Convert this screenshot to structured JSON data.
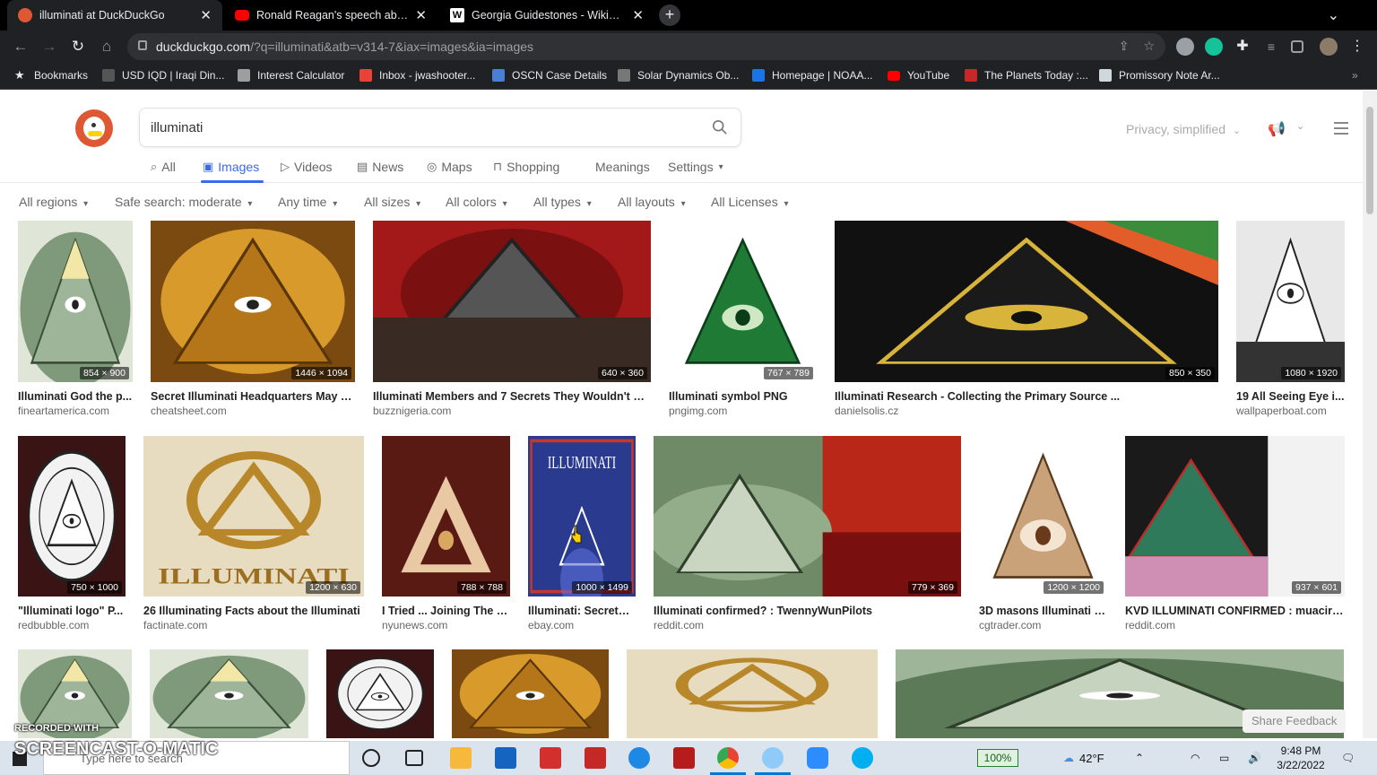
{
  "browser": {
    "tabs": [
      {
        "title": "illuminati at DuckDuckGo",
        "favicon_color": "#de5833",
        "active": true
      },
      {
        "title": "Ronald Reagan's speech about a",
        "favicon_color": "#ff0000",
        "active": false
      },
      {
        "title": "Georgia Guidestones - Wikipedia",
        "favicon_color": "#ffffff",
        "active": false
      }
    ],
    "new_tab": "+",
    "url_host": "duckduckgo.com",
    "url_path": "/?q=illuminati&atb=v314-7&iax=images&ia=images",
    "bookmarks": [
      {
        "label": "Bookmarks",
        "color": "#e8eaed"
      },
      {
        "label": "USD IQD | Iraqi Din...",
        "color": "#444"
      },
      {
        "label": "Interest Calculator",
        "color": "#9e9e9e"
      },
      {
        "label": "Inbox - jwashooter...",
        "color": "#ea4335"
      },
      {
        "label": "OSCN Case Details",
        "color": "#4a7fd6"
      },
      {
        "label": "Solar Dynamics Ob...",
        "color": "#777"
      },
      {
        "label": "Homepage | NOAA...",
        "color": "#1a73e8"
      },
      {
        "label": "YouTube",
        "color": "#ff0000"
      },
      {
        "label": "The Planets Today :...",
        "color": "#c62828"
      },
      {
        "label": "Promissory Note Ar...",
        "color": "#cfd8dc"
      }
    ],
    "chevron": "»"
  },
  "ddg": {
    "query": "illuminati",
    "privacy_label": "Privacy, simplified",
    "nav": [
      {
        "label": "All",
        "icon": "search-icon",
        "glyph": "⌕",
        "active": false
      },
      {
        "label": "Images",
        "icon": "image-icon",
        "glyph": "▣",
        "active": true
      },
      {
        "label": "Videos",
        "icon": "play-icon",
        "glyph": "▷",
        "active": false
      },
      {
        "label": "News",
        "icon": "newspaper-icon",
        "glyph": "▤",
        "active": false
      },
      {
        "label": "Maps",
        "icon": "pin-icon",
        "glyph": "◎",
        "active": false
      },
      {
        "label": "Shopping",
        "icon": "bag-icon",
        "glyph": "⊓",
        "active": false
      },
      {
        "label": "Meanings",
        "icon": "",
        "glyph": "",
        "active": false
      },
      {
        "label": "Settings",
        "icon": "chevron-down-icon",
        "glyph": "▾",
        "active": false
      }
    ],
    "filters": [
      "All regions",
      "Safe search: moderate",
      "Any time",
      "All sizes",
      "All colors",
      "All types",
      "All layouts",
      "All Licenses"
    ],
    "results_row1": [
      {
        "title": "Illuminati God the p...",
        "source": "fineartamerica.com",
        "dims": "854 × 900",
        "theme": "dollar"
      },
      {
        "title": "Secret Illuminati Headquarters May B...",
        "source": "cheatsheet.com",
        "dims": "1446 × 1094",
        "theme": "gold"
      },
      {
        "title": "Illuminati Members and 7 Secrets They Wouldn't W...",
        "source": "buzznigeria.com",
        "dims": "640 × 360",
        "theme": "red"
      },
      {
        "title": "Illuminati symbol PNG",
        "source": "pngimg.com",
        "dims": "767 × 789",
        "theme": "greentri"
      },
      {
        "title": "Illuminati Research - Collecting the Primary Source ...",
        "source": "danielsolis.cz",
        "dims": "850 × 350",
        "theme": "goldblack"
      },
      {
        "title": "19 All Seeing Eye i...",
        "source": "wallpaperboat.com",
        "dims": "1080 × 1920",
        "theme": "bw"
      }
    ],
    "results_row2": [
      {
        "title": "\"Illuminati logo\" P...",
        "source": "redbubble.com",
        "dims": "750 × 1000",
        "theme": "seal"
      },
      {
        "title": "26 Illuminating Facts about the Illuminati",
        "source": "factinate.com",
        "dims": "1200 × 630",
        "theme": "goldlogo",
        "caption": "ILLUMINATI"
      },
      {
        "title": "I Tried ... Joining The Il...",
        "source": "nyunews.com",
        "dims": "788 × 788",
        "theme": "hands"
      },
      {
        "title": "Illuminati: Secrets ...",
        "source": "ebay.com",
        "dims": "1000 × 1499",
        "theme": "book",
        "caption": "ILLUMINATI"
      },
      {
        "title": "Illuminati confirmed? : TwennyWunPilots",
        "source": "reddit.com",
        "dims": "779 × 369",
        "theme": "dollarred"
      },
      {
        "title": "3D masons Illuminati S...",
        "source": "cgtrader.com",
        "dims": "1200 × 1200",
        "theme": "eyetri"
      },
      {
        "title": "KVD ILLUMINATI CONFIRMED : muacirc...",
        "source": "reddit.com",
        "dims": "937 × 601",
        "theme": "kvd"
      }
    ],
    "results_row3": [
      {
        "theme": "dollar"
      },
      {
        "theme": "dollar"
      },
      {
        "theme": "seal"
      },
      {
        "theme": "gold"
      },
      {
        "theme": "goldlogo"
      },
      {
        "theme": "dollarwide"
      }
    ],
    "share_feedback": "Share Feedback"
  },
  "taskbar": {
    "search_placeholder": "Type here to search",
    "zoom": "100%",
    "weather": "42°F",
    "time": "9:48 PM",
    "date": "3/22/2022"
  },
  "watermark": {
    "line1": "RECORDED WITH",
    "line2": "SCREENCAST-O-MATIC"
  }
}
